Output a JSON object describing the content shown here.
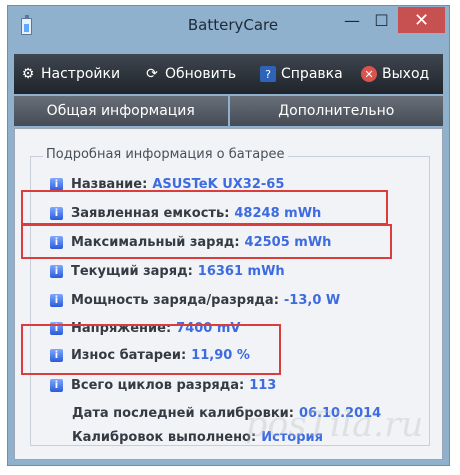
{
  "window": {
    "title": "BatteryCare",
    "icon": "battery-icon"
  },
  "title_controls": {
    "minimize": "—",
    "maximize": "☐",
    "close": "✕"
  },
  "toolbar": {
    "settings": {
      "label": "Настройки",
      "icon": "gear-icon"
    },
    "refresh": {
      "label": "Обновить",
      "icon": "refresh-icon"
    },
    "help": {
      "label": "Справка",
      "icon": "help-icon"
    },
    "exit": {
      "label": "Выход",
      "icon": "exit-icon"
    }
  },
  "tabs": [
    {
      "label": "Общая информация"
    },
    {
      "label": "Дополнительно"
    }
  ],
  "details": {
    "group_title": "Подробная информация о батарее",
    "rows": [
      {
        "label": "Название:",
        "value": "ASUSTeK UX32-65"
      },
      {
        "label": "Заявленная емкость:",
        "value": "48248 mWh"
      },
      {
        "label": "Максимальный заряд:",
        "value": "42505 mWh"
      },
      {
        "label": "Текущий заряд:",
        "value": "16361 mWh"
      },
      {
        "label": "Мощность заряда/разряда:",
        "value": "-13,0 W"
      },
      {
        "label": "Напряжение:",
        "value": "7400 mV"
      },
      {
        "label": "Износ батареи:",
        "value": "11,90 %"
      },
      {
        "label": "Всего циклов разряда:",
        "value": "113"
      },
      {
        "label": "Дата последней калибровки:",
        "value": "06.10.2014"
      },
      {
        "label": "Калибровок выполнено:",
        "value": "История"
      }
    ]
  },
  "watermark": "posTila.ru",
  "colors": {
    "toolbar": "#2f3540",
    "highlight": "#db3d3d",
    "value": "#3d6be0"
  }
}
